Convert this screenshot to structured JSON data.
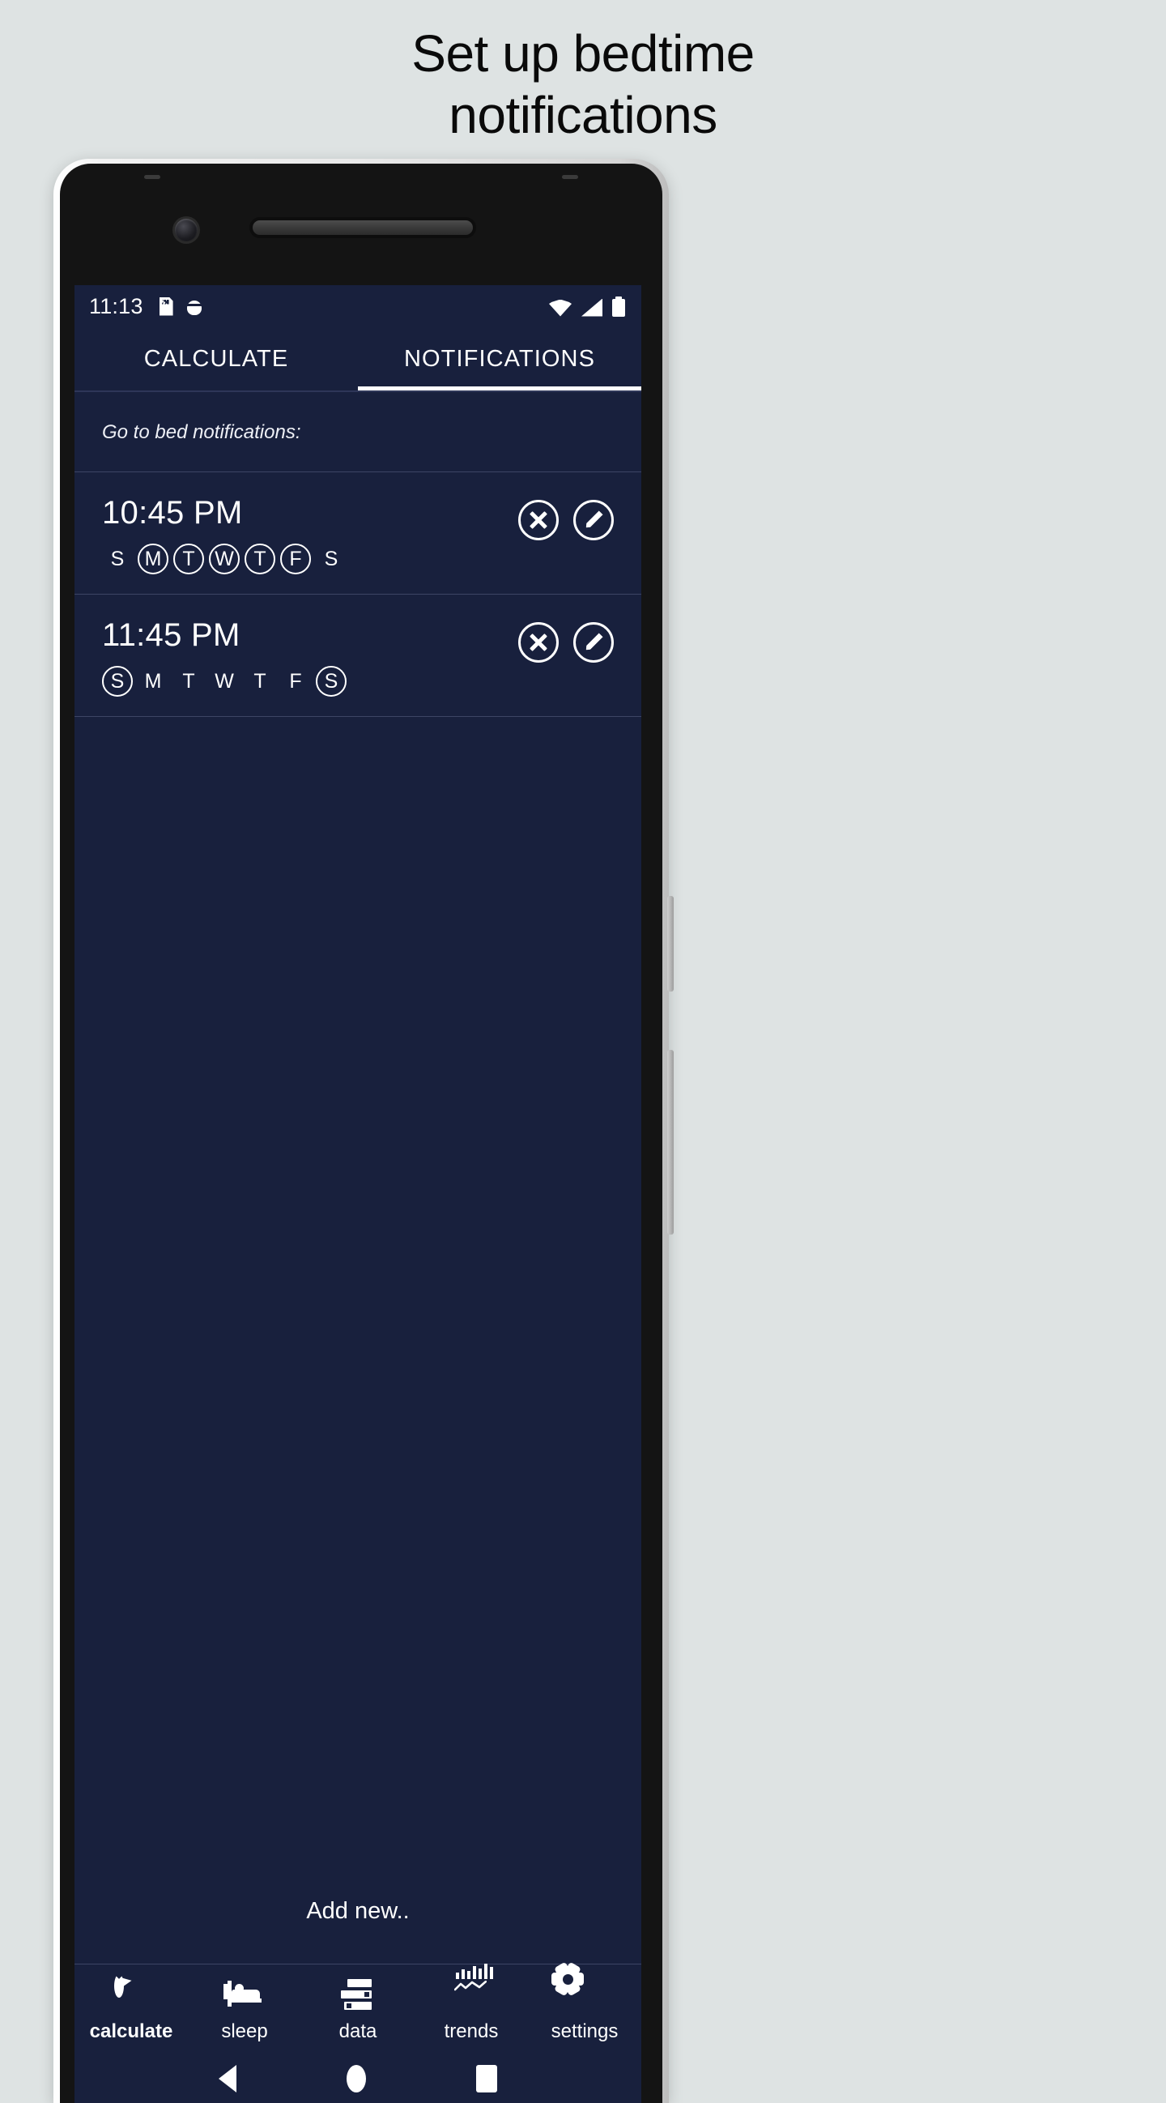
{
  "promo": {
    "line1": "Set up bedtime",
    "line2": "notifications"
  },
  "statusbar": {
    "time": "11:13",
    "icons": [
      "sd-card-icon",
      "android-debug-icon",
      "wifi-icon",
      "cellular-signal-icon",
      "battery-icon"
    ]
  },
  "tabs": [
    {
      "label": "CALCULATE",
      "active": false
    },
    {
      "label": "NOTIFICATIONS",
      "active": true
    }
  ],
  "section": {
    "label": "Go to bed notifications:"
  },
  "alarms": [
    {
      "time": "10:45 PM",
      "days": [
        {
          "letter": "S",
          "on": false
        },
        {
          "letter": "M",
          "on": true
        },
        {
          "letter": "T",
          "on": true
        },
        {
          "letter": "W",
          "on": true
        },
        {
          "letter": "T",
          "on": true
        },
        {
          "letter": "F",
          "on": true
        },
        {
          "letter": "S",
          "on": false
        }
      ],
      "delete_label": "delete-alarm",
      "edit_label": "edit-alarm"
    },
    {
      "time": "11:45 PM",
      "days": [
        {
          "letter": "S",
          "on": true
        },
        {
          "letter": "M",
          "on": false
        },
        {
          "letter": "T",
          "on": false
        },
        {
          "letter": "W",
          "on": false
        },
        {
          "letter": "T",
          "on": false
        },
        {
          "letter": "F",
          "on": false
        },
        {
          "letter": "S",
          "on": true
        }
      ],
      "delete_label": "delete-alarm",
      "edit_label": "edit-alarm"
    }
  ],
  "add_new": {
    "label": "Add new.."
  },
  "bottomnav": [
    {
      "label": "calculate",
      "icon": "refresh-icon",
      "active": true
    },
    {
      "label": "sleep",
      "icon": "bed-icon",
      "active": false
    },
    {
      "label": "data",
      "icon": "list-icon",
      "active": false
    },
    {
      "label": "trends",
      "icon": "chart-icon",
      "active": false
    },
    {
      "label": "settings",
      "icon": "gear-icon",
      "active": false
    }
  ],
  "androidnav": [
    {
      "name": "back-button"
    },
    {
      "name": "home-button"
    },
    {
      "name": "recents-button"
    }
  ],
  "colors": {
    "page_bg": "#dee3e3",
    "app_bg": "#18203d",
    "accent": "#ffffff",
    "divider": "#3d4564"
  }
}
